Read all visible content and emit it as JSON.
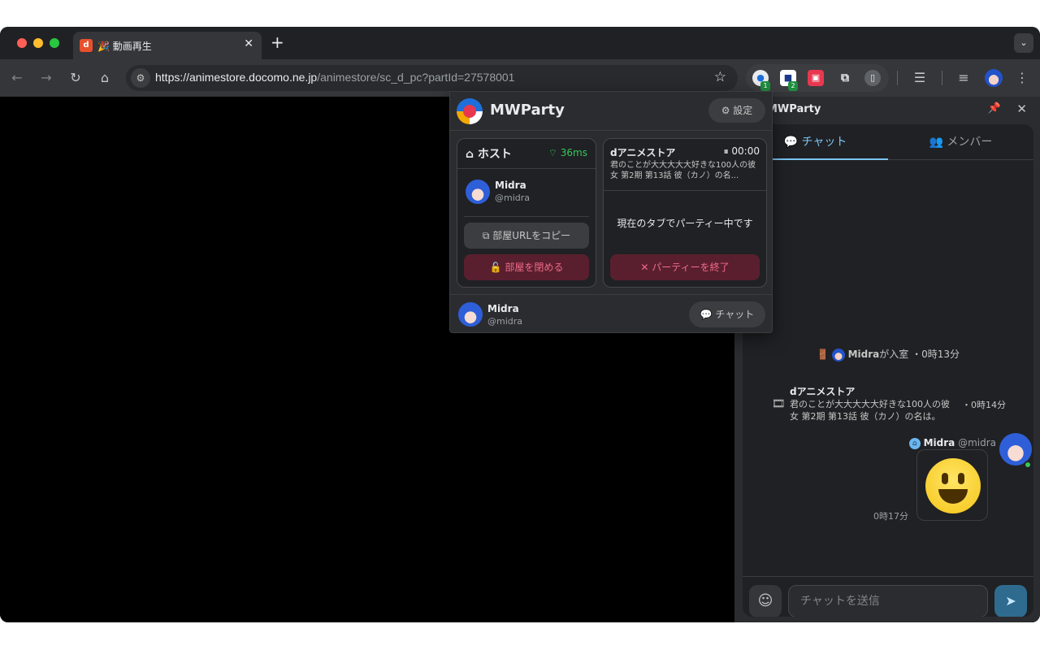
{
  "browser": {
    "tab_title": "🎉 動画再生",
    "tab_favicon": "d",
    "tab_close": "✕",
    "new_tab": "+",
    "tab_search": "⌄",
    "url_host": "https://animestore.docomo.ne.jp",
    "url_path": "/animestore/sc_d_pc?partId=27578001",
    "extension_badges": [
      "1",
      "2"
    ],
    "icons": {
      "back": "←",
      "forward": "→",
      "reload": "↻",
      "home": "⌂",
      "site_info": "⚙",
      "star": "☆",
      "menu": "⋮",
      "reading_list": "☰",
      "media": "≡"
    }
  },
  "popup": {
    "title": "MWParty",
    "settings_label": "⚙ 設定",
    "host_card": {
      "title": "⌂ ホスト",
      "ping": "⌔ 36ms",
      "user_name": "Midra",
      "user_handle": "@midra",
      "copy_button": "⧉ 部屋URLをコピー",
      "close_button": "🔓 部屋を閉める"
    },
    "media_card": {
      "service": "dアニメストア",
      "time": "⏸ 00:00",
      "episode": "君のことが大大大大大好きな100人の彼女 第2期 第13話 彼（カノ）の名...",
      "status": "現在のタブでパーティー中です",
      "end_button": "✕ パーティーを終了"
    },
    "footer": {
      "user_name": "Midra",
      "user_handle": "@midra",
      "chat_button": "💬 チャット"
    }
  },
  "side_panel": {
    "title": "MWParty",
    "pin_icon": "📌",
    "close_icon": "✕",
    "tabs": [
      {
        "label": "💬 チャット",
        "active": true
      },
      {
        "label": "👥 メンバー",
        "active": false
      }
    ],
    "system_message": {
      "icon": "🚪",
      "name": "Midra",
      "text": "が入室",
      "time": "・0時13分"
    },
    "media_message": {
      "service": "dアニメストア",
      "episode": "君のことが大大大大大好きな100人の彼女 第2期 第13話 彼（カノ）の名は。",
      "time": "・0時14分",
      "icon": "🎞"
    },
    "chat_message": {
      "name": "Midra",
      "handle": "@midra",
      "time": "0時17分",
      "content": "😃"
    },
    "input": {
      "placeholder": "チャットを送信",
      "emoji_icon": "☺",
      "send_icon": "➤"
    }
  },
  "colors": {
    "accent": "#7cc6f5",
    "online": "#34c759",
    "danger_bg": "#5a1f2e",
    "danger_text": "#f06a8a"
  }
}
